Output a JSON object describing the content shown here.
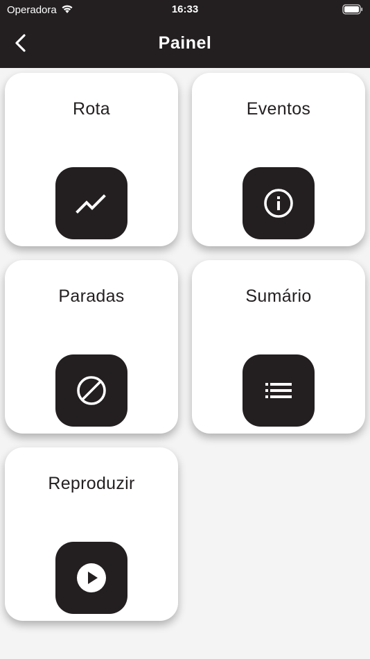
{
  "status_bar": {
    "carrier": "Operadora",
    "time": "16:33",
    "wifi_icon": "wifi-icon",
    "battery_icon": "battery-icon"
  },
  "nav": {
    "title": "Painel",
    "back_icon": "chevron-left-icon"
  },
  "colors": {
    "bar_background": "#231f20",
    "page_background": "#f4f4f4",
    "tile_background": "#ffffff",
    "icon_background": "#231f20",
    "icon_foreground": "#ffffff"
  },
  "tiles": [
    {
      "label": "Rota",
      "icon": "trending-up-icon"
    },
    {
      "label": "Eventos",
      "icon": "info-icon"
    },
    {
      "label": "Paradas",
      "icon": "block-icon"
    },
    {
      "label": "Sumário",
      "icon": "list-icon"
    },
    {
      "label": "Reproduzir",
      "icon": "play-circle-icon"
    }
  ]
}
